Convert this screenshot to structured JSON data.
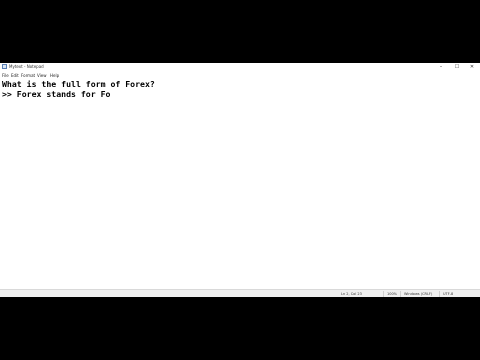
{
  "window": {
    "title": "Mytext - Notepad",
    "controls": {
      "minimize": "–",
      "maximize": "☐",
      "close": "✕"
    }
  },
  "menu": [
    "File",
    "Edit",
    "Format",
    "View",
    "Help"
  ],
  "editor": {
    "lines": [
      "What is the full form of Forex?",
      ">> Forex stands for Fo"
    ]
  },
  "statusbar": {
    "position": "Ln 2, Col 23",
    "zoom": "100%",
    "line_ending": "Windows (CRLF)",
    "encoding": "UTF-8"
  }
}
